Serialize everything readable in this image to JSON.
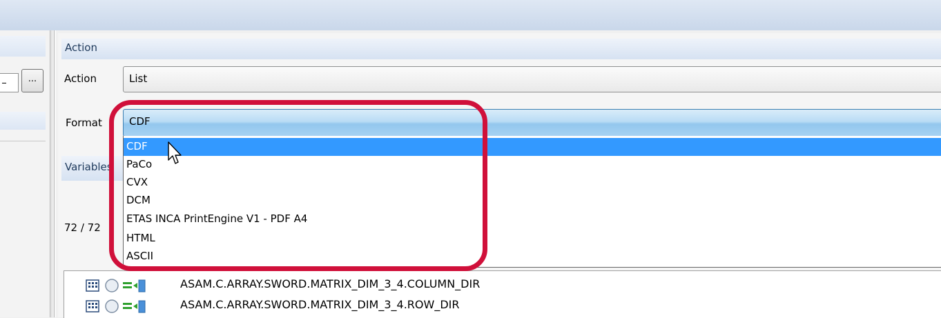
{
  "left_panel": {
    "browse_label": "..."
  },
  "action_section": {
    "header": "Action",
    "action_label": "Action",
    "action_value": "List",
    "format_label": "Format",
    "format_value": "CDF"
  },
  "variables_section": {
    "header": "Variables",
    "count": "72 / 72"
  },
  "format_dropdown": {
    "options": [
      "CDF",
      "PaCo",
      "CVX",
      "DCM",
      "ETAS INCA PrintEngine V1 - PDF A4",
      "HTML",
      "ASCII"
    ],
    "selected_index": 0
  },
  "tree": {
    "rows": [
      {
        "label": "ASAM.C.ARRAY.SWORD.MATRIX_DIM_3_4.COLUMN_DIR",
        "icon": "variable-icon"
      },
      {
        "label": "ASAM.C.ARRAY.SWORD.MATRIX_DIM_3_4.ROW_DIR",
        "icon": "variable-icon"
      }
    ]
  },
  "colors": {
    "selection": "#3399ff",
    "highlight": "#d0103a",
    "section_title": "#1e395b"
  }
}
